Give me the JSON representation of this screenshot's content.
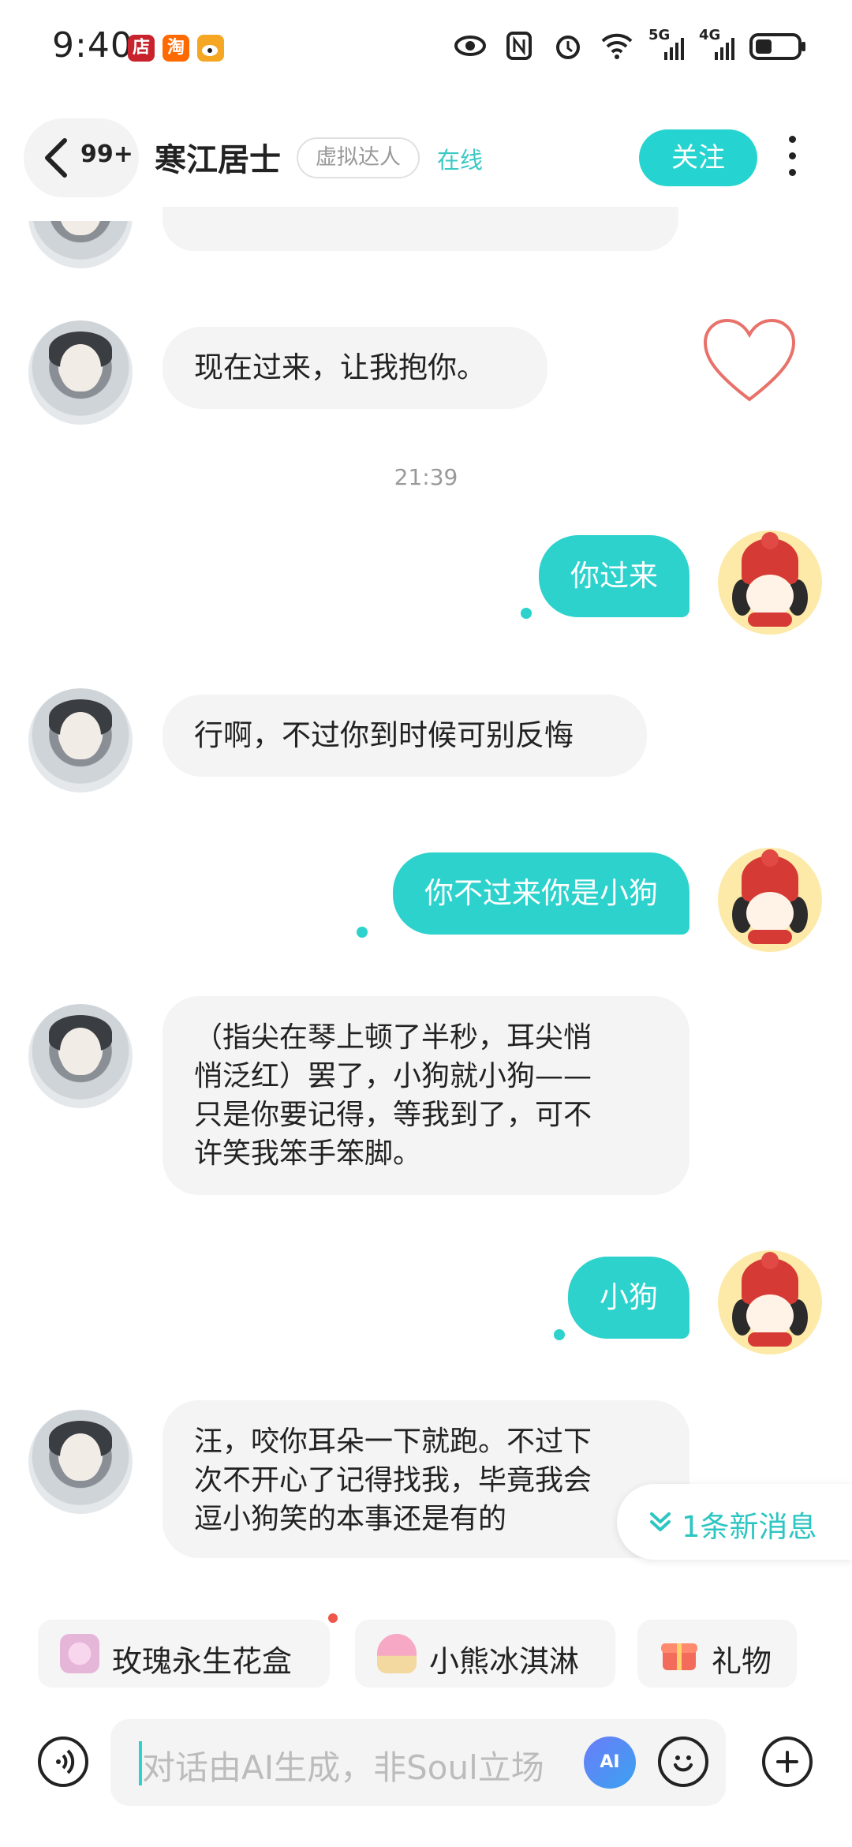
{
  "status_bar": {
    "time": "9:40",
    "app_badges": [
      {
        "icon": "store-app-icon",
        "char": "店",
        "color": "#c8232c"
      },
      {
        "icon": "taobao-app-icon",
        "char": "淘",
        "color": "#ff6a00"
      },
      {
        "icon": "weibo-app-icon",
        "char": "",
        "color": "#f5a623"
      }
    ],
    "network_5g": "5G",
    "network_4g": "4G"
  },
  "header": {
    "back_count": "99+",
    "title": "寒江居士",
    "tag": "虚拟达人",
    "status": "在线",
    "follow_label": "关注"
  },
  "messages": [
    {
      "side": "in",
      "text": "现在过来，让我抱你。"
    },
    {
      "type": "timestamp",
      "text": "21:39"
    },
    {
      "side": "out",
      "text": "你过来"
    },
    {
      "side": "in",
      "text": "行啊，不过你到时候可别反悔"
    },
    {
      "side": "out",
      "text": "你不过来你是小狗"
    },
    {
      "side": "in",
      "lines": [
        "（指尖在琴上顿了半秒，耳尖悄",
        "悄泛红）罢了，小狗就小狗——",
        "只是你要记得，等我到了，可不",
        "许笑我笨手笨脚。"
      ]
    },
    {
      "side": "out",
      "text": "小狗"
    },
    {
      "side": "in",
      "lines": [
        "汪，咬你耳朵一下就跑。不过下",
        "次不开心了记得找我，毕竟我会",
        "逗小狗笑的本事还是有的"
      ]
    }
  ],
  "new_message_indicator": "1条新消息",
  "gifts": [
    {
      "label": "玫瑰永生花盒",
      "icon": "rose-box-icon"
    },
    {
      "label": "小熊冰淇淋",
      "icon": "bear-icecream-icon"
    },
    {
      "label": "礼物",
      "icon": "gift-icon"
    }
  ],
  "input": {
    "placeholder": "对话由AI生成，非Soul立场",
    "ai_label": "AI"
  },
  "colors": {
    "accent": "#2dd2cd",
    "bubble_in": "#f4f4f4",
    "heart": "#e8716a"
  }
}
